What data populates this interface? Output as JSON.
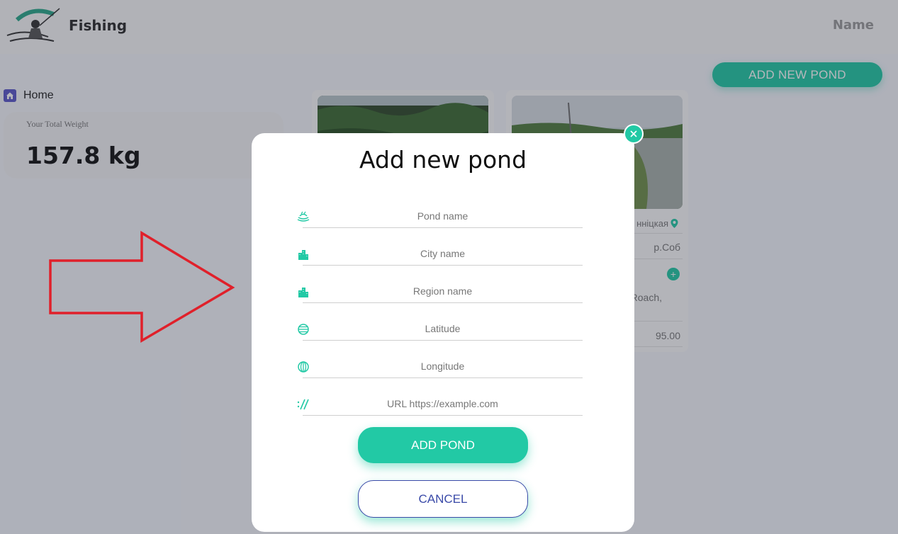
{
  "header": {
    "app_title": "Fishing",
    "user_name": "Name",
    "logo_icon": "fisherman-logo-icon"
  },
  "toolbar": {
    "add_new_pond_label": "ADD NEW POND"
  },
  "sidebar": {
    "home_label": "Home"
  },
  "stats": {
    "weight_label": "Your Total Weight",
    "weight_value": "157.8 kg"
  },
  "pond_cards": [
    {
      "region": "",
      "river": "",
      "fish": "",
      "weight": ""
    },
    {
      "region": "нніцкая",
      "river": "р.Соб",
      "fish": "Roach,",
      "weight": "95.00"
    }
  ],
  "modal": {
    "title": "Add new pond",
    "fields": [
      {
        "placeholder": "Pond name",
        "icon": "pond-icon"
      },
      {
        "placeholder": "City name",
        "icon": "city-icon"
      },
      {
        "placeholder": "Region name",
        "icon": "city-icon"
      },
      {
        "placeholder": "Latitude",
        "icon": "latitude-icon"
      },
      {
        "placeholder": "Longitude",
        "icon": "longitude-icon"
      },
      {
        "placeholder": "URL https://example.com",
        "icon": "url-icon"
      }
    ],
    "submit_label": "ADD POND",
    "cancel_label": "CANCEL"
  },
  "colors": {
    "accent": "#22c9a5",
    "cancel_border": "#3a4aa8",
    "annotation_arrow": "#e0202a"
  }
}
